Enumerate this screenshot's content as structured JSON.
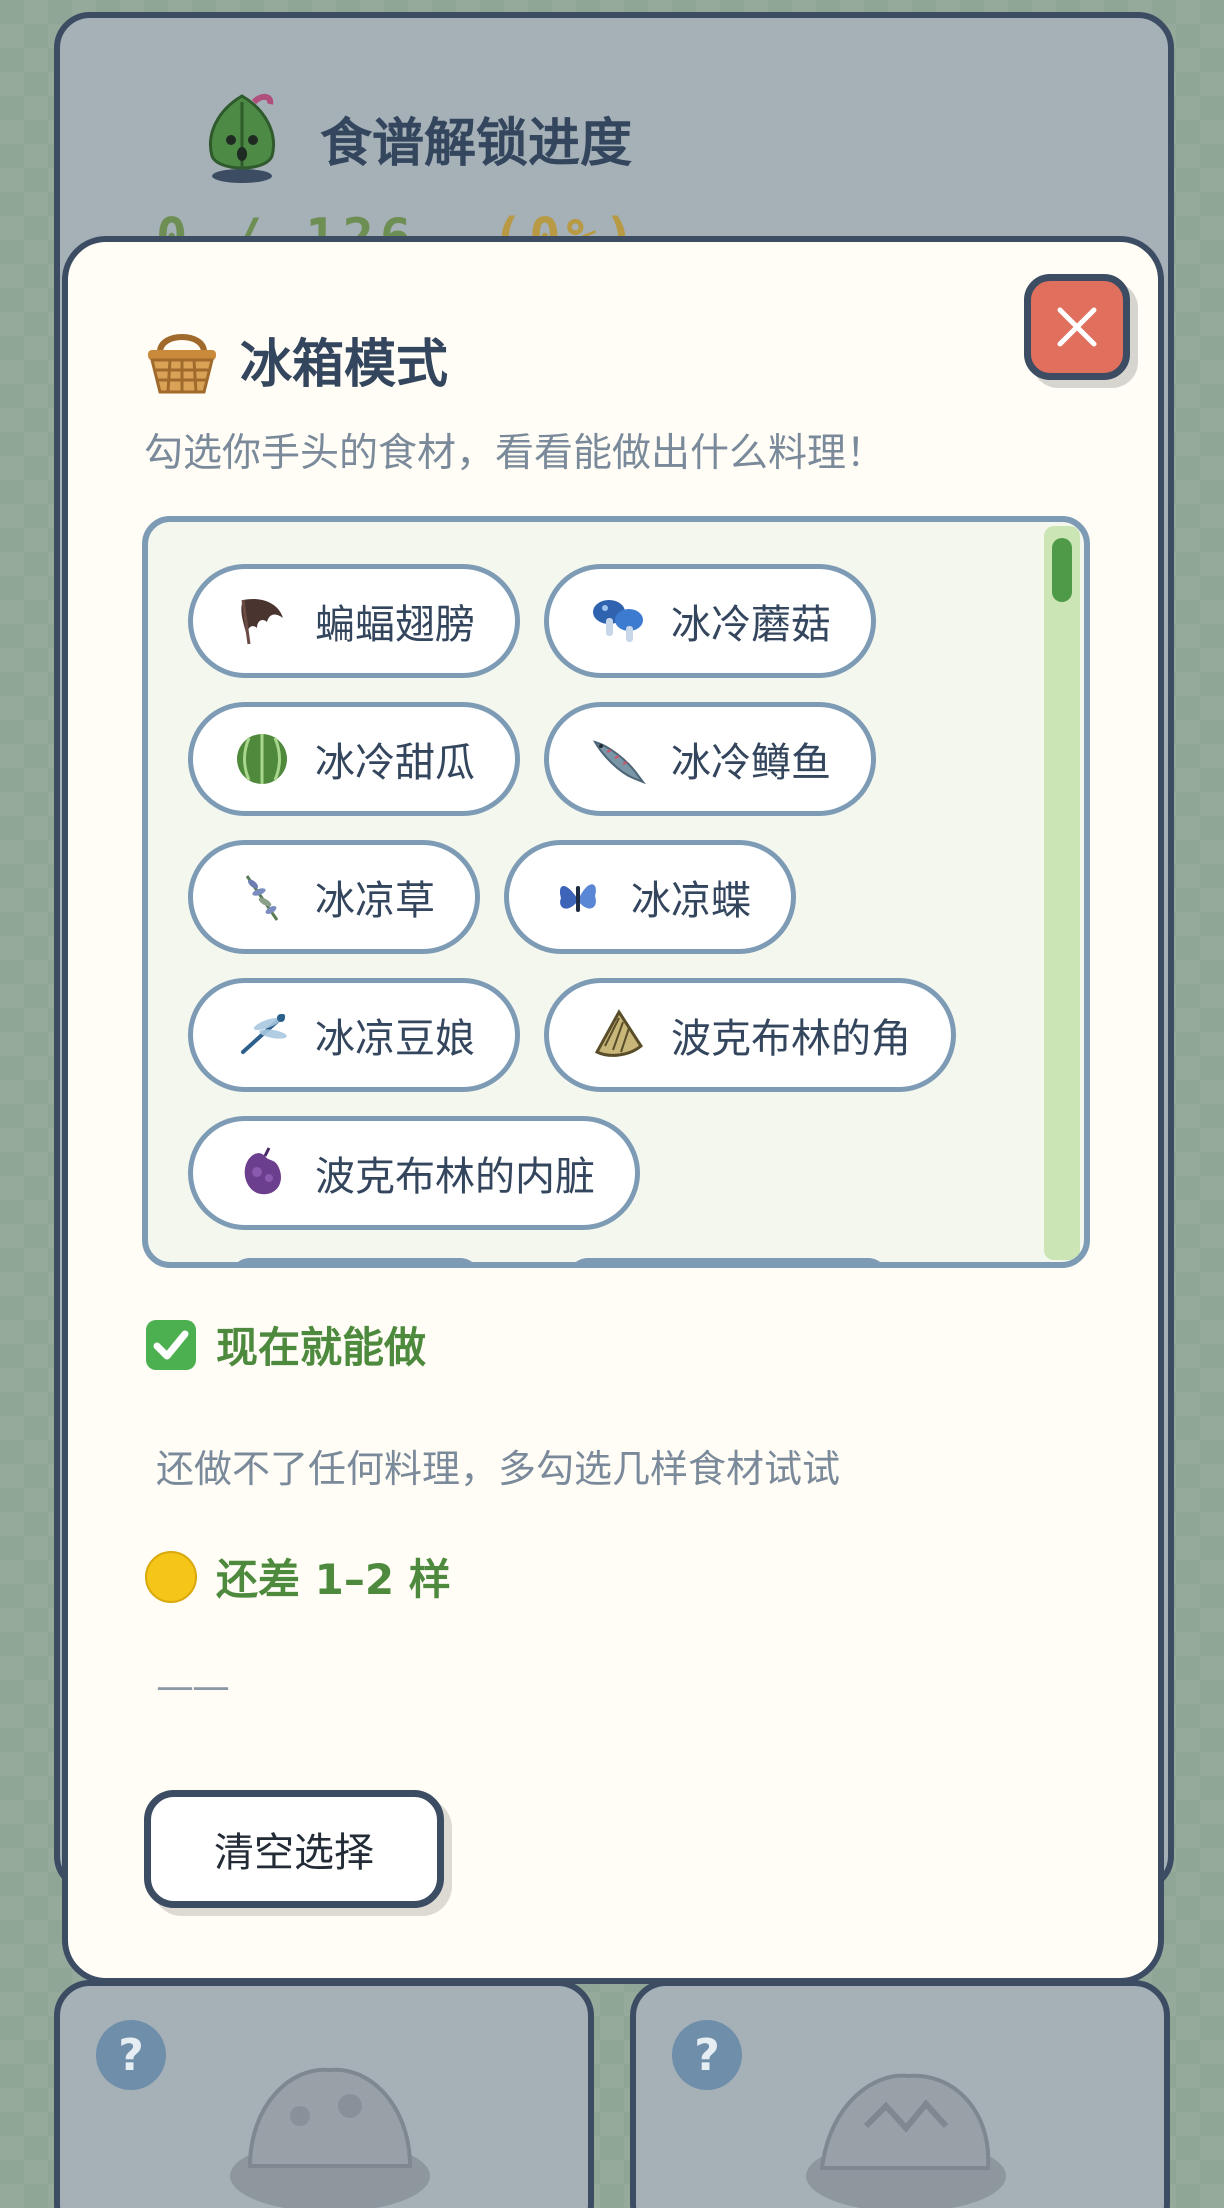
{
  "background": {
    "progress_title": "食谱解锁进度",
    "progress_count": "0 / 126",
    "progress_percent": "(0%)",
    "recipe_cards": [
      {
        "badge": "?"
      },
      {
        "badge": "?"
      }
    ]
  },
  "modal": {
    "title": "冰箱模式",
    "subtitle": "勾选你手头的食材，看看能做出什么料理！",
    "close_icon": "close-icon",
    "ingredients": [
      {
        "label": "蝙蝠翅膀",
        "icon": "bat-wing-icon"
      },
      {
        "label": "冰冷蘑菇",
        "icon": "blue-mushroom-icon"
      },
      {
        "label": "冰冷甜瓜",
        "icon": "melon-icon"
      },
      {
        "label": "冰冷鳟鱼",
        "icon": "trout-icon"
      },
      {
        "label": "冰凉草",
        "icon": "herb-icon"
      },
      {
        "label": "冰凉蝶",
        "icon": "butterfly-icon"
      },
      {
        "label": "冰凉豆娘",
        "icon": "dragonfly-icon"
      },
      {
        "label": "波克布林的角",
        "icon": "horn-icon"
      },
      {
        "label": "波克布林的内脏",
        "icon": "guts-icon"
      }
    ],
    "can_make": {
      "title": "现在就能做",
      "icon": "check-icon",
      "empty_text": "还做不了任何料理，多勾选几样食材试试"
    },
    "almost": {
      "title": "还差 1–2 样",
      "icon": "yellow-circle-icon",
      "empty_text": "——"
    },
    "clear_button": "清空选择"
  },
  "colors": {
    "accent_green": "#4e8a3e",
    "border_navy": "#3b4c63",
    "close_red": "#e0705d",
    "chip_border": "#7d9bb5",
    "scroll_green": "#4f9a48"
  }
}
